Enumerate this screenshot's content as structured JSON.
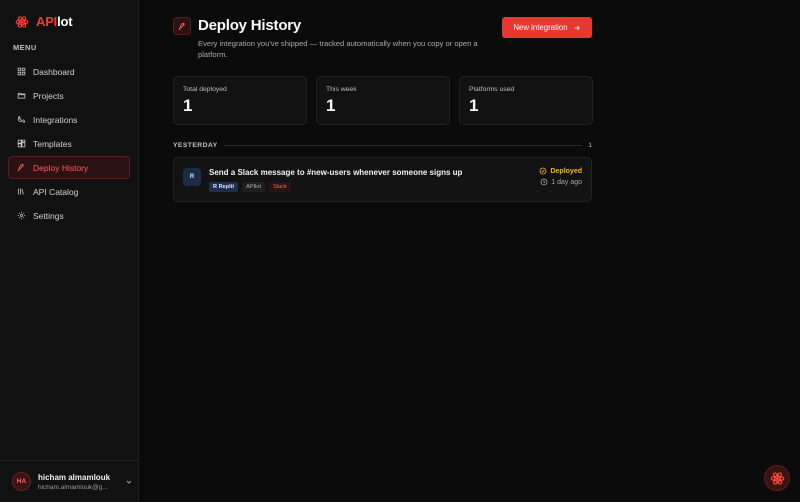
{
  "app": {
    "brand_prefix": "API",
    "brand_suffix": "lot",
    "accent_color": "#e8372f"
  },
  "sidebar": {
    "menu_label": "MENU",
    "items": [
      {
        "label": "Dashboard",
        "icon": "grid-icon",
        "active": false
      },
      {
        "label": "Projects",
        "icon": "folder-icon",
        "active": false
      },
      {
        "label": "Integrations",
        "icon": "plug-icon",
        "active": false
      },
      {
        "label": "Templates",
        "icon": "template-icon",
        "active": false
      },
      {
        "label": "Deploy History",
        "icon": "rocket-icon",
        "active": true
      },
      {
        "label": "API Catalog",
        "icon": "library-icon",
        "active": false
      },
      {
        "label": "Settings",
        "icon": "gear-icon",
        "active": false
      }
    ],
    "user": {
      "initials": "HA",
      "name": "hicham almamlouk",
      "email": "hicham.almamlouk@g..."
    }
  },
  "header": {
    "title": "Deploy History",
    "subtitle": "Every integration you've shipped — tracked automatically when you copy or open a platform.",
    "new_button": "New integration"
  },
  "stats": [
    {
      "label": "Total deployed",
      "value": "1"
    },
    {
      "label": "This week",
      "value": "1"
    },
    {
      "label": "Platforms used",
      "value": "1"
    }
  ],
  "groups": [
    {
      "label": "YESTERDAY",
      "count": "1",
      "deploys": [
        {
          "badge": "R",
          "title": "Send a Slack message to #new-users whenever someone signs up",
          "tags": [
            "R Replit",
            "APIlot",
            "Slack"
          ],
          "status": "Deployed",
          "time": "1 day ago"
        }
      ]
    }
  ]
}
